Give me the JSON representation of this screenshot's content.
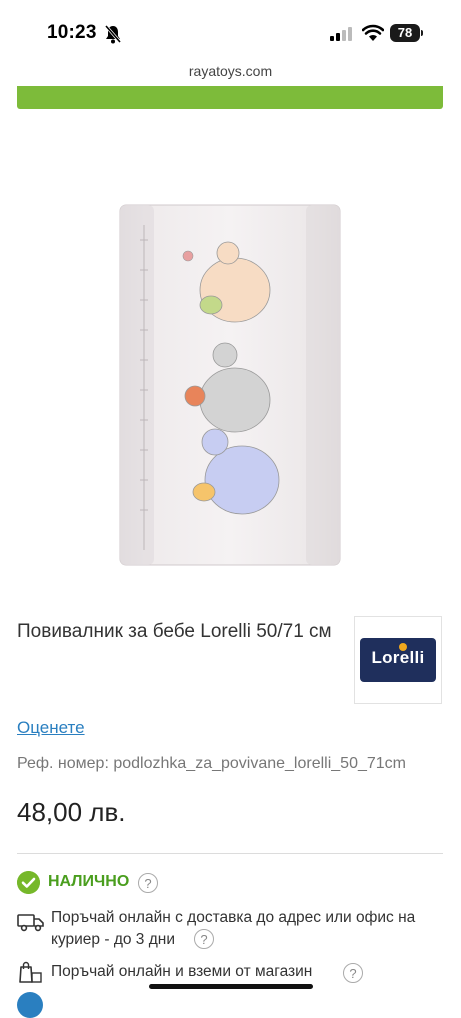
{
  "status_bar": {
    "time": "10:23",
    "battery": "78",
    "icons": [
      "bell-slash-icon",
      "signal-icon",
      "wifi-icon",
      "battery-icon"
    ]
  },
  "browser": {
    "url": "rayatoys.com"
  },
  "colors": {
    "accent_green": "#7dbb3a",
    "link_blue": "#2a7fc0",
    "brand_navy": "#1f2f5c",
    "stock_green": "#4a9e1e"
  },
  "product": {
    "title": "Повивалник за бебе Lorelli 50/71 см",
    "brand": {
      "name": "Lorelli"
    },
    "rate_label": "Оценете",
    "ref": "Реф. номер: podlozhka_za_povivane_lorelli_50_71cm",
    "price": "48,00 лв."
  },
  "availability": {
    "stock_label": "НАЛИЧНО",
    "delivery_text": "Поръчай онлайн с доставка до адрес или офис на куриер - до 3 дни",
    "store_text": "Поръчай онлайн и вземи от магазин",
    "help_symbol": "?"
  }
}
